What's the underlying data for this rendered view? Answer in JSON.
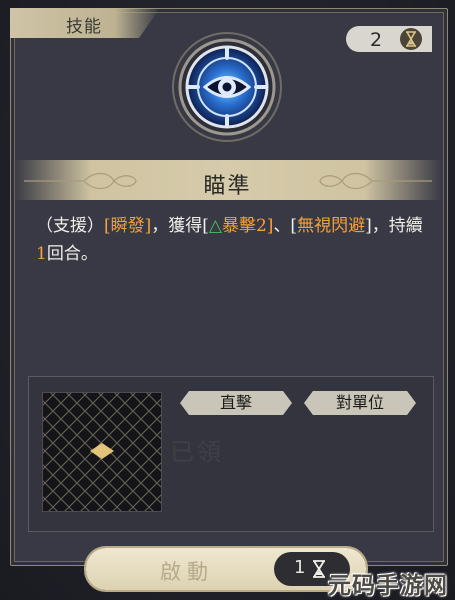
{
  "panel": {
    "title": "技能",
    "counter": "2"
  },
  "skill": {
    "name": "瞄準",
    "icon": "eye-icon",
    "description_parts": {
      "p1": "（支援）",
      "p2": "[瞬發]",
      "p3": "，獲得[",
      "p4": "△",
      "p5": "暴擊2]",
      "p6": "、[",
      "p7": "無視閃避",
      "p8": "]，持續",
      "p9": "1",
      "p10": "回合。"
    }
  },
  "tags": {
    "tag1": "直擊",
    "tag2": "對單位"
  },
  "range_faint_text": "已領",
  "action": {
    "label": "啟動",
    "cost": "1"
  },
  "watermark": "元码手游网",
  "colors": {
    "highlight": "#f5a03a",
    "buff": "#49c25a",
    "panel": "#383944"
  }
}
